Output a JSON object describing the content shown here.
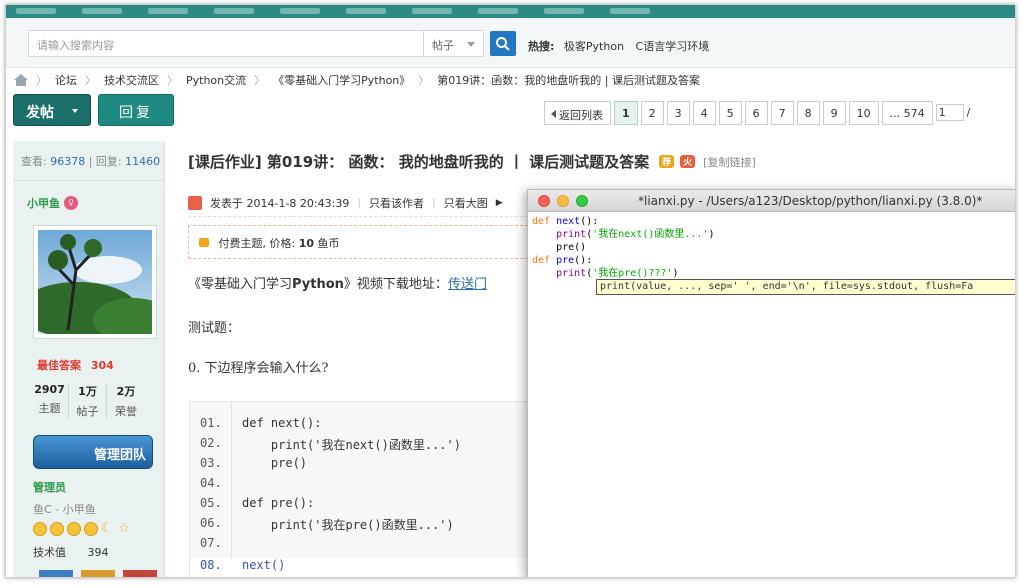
{
  "search": {
    "placeholder": "请输入搜索内容",
    "scope": "帖子",
    "hot_label": "热搜:",
    "hot_links": [
      "极客Python",
      "C语言学习环境"
    ]
  },
  "breadcrumb": [
    "论坛",
    "技术交流区",
    "Python交流",
    "《零基础入门学习Python》",
    "第019讲：函数：我的地盘听我的 | 课后测试题及答案"
  ],
  "actions": {
    "post": "发帖",
    "reply": "回复"
  },
  "pager": {
    "back": "返回列表",
    "pages": [
      "1",
      "2",
      "3",
      "4",
      "5",
      "6",
      "7",
      "8",
      "9",
      "10"
    ],
    "current": "1",
    "last": "... 574",
    "jump_value": "1",
    "slash": "/"
  },
  "thread_stats": {
    "views_label": "查看:",
    "views": "96378",
    "replies_label": "回复:",
    "replies": "11460"
  },
  "thread": {
    "title": "[课后作业] 第019讲： 函数： 我的地盘听我的 丨 课后测试题及答案",
    "tag1": "荐",
    "tag2": "火",
    "copy_link": "[复制链接]"
  },
  "author": {
    "name": "小甲鱼",
    "best_label": "最佳答案",
    "best": "304",
    "stats": [
      {
        "n": "2907",
        "l": "主题"
      },
      {
        "n": "1万",
        "l": "帖子"
      },
      {
        "n": "2万",
        "l": "荣誉"
      }
    ],
    "team_button": "管理团队",
    "role": "管理员",
    "title": "鱼C - 小甲鱼",
    "skill_label": "技术值",
    "skill": "394"
  },
  "post_meta": {
    "posted": "发表于 2014-1-8 20:43:39",
    "only_author": "只看该作者",
    "only_big": "只看大图"
  },
  "paid": {
    "prefix": "付费主题, 价格: ",
    "price": "10",
    "unit": " 鱼币"
  },
  "content": {
    "video_prefix": "《零基础入门学习",
    "video_bold": "Python",
    "video_suffix": "》视频下载地址：",
    "video_link": "传送门",
    "test_title": "测试题：",
    "q0": "0. 下边程序会输入什么?"
  },
  "code": [
    {
      "ln": "01.",
      "tx": "def next():"
    },
    {
      "ln": "02.",
      "tx": "    print('我在next()函数里...')"
    },
    {
      "ln": "03.",
      "tx": "    pre()"
    },
    {
      "ln": "04.",
      "tx": ""
    },
    {
      "ln": "05.",
      "tx": "def pre():"
    },
    {
      "ln": "06.",
      "tx": "    print('我在pre()函数里...')"
    },
    {
      "ln": "07.",
      "tx": ""
    },
    {
      "ln": "08.",
      "tx": "next()"
    }
  ],
  "idle": {
    "window_title": "*lianxi.py - /Users/a123/Desktop/python/lianxi.py (3.8.0)*",
    "calltip": "print(value, ..., sep=' ', end='\\n', file=sys.stdout, flush=Fa"
  }
}
